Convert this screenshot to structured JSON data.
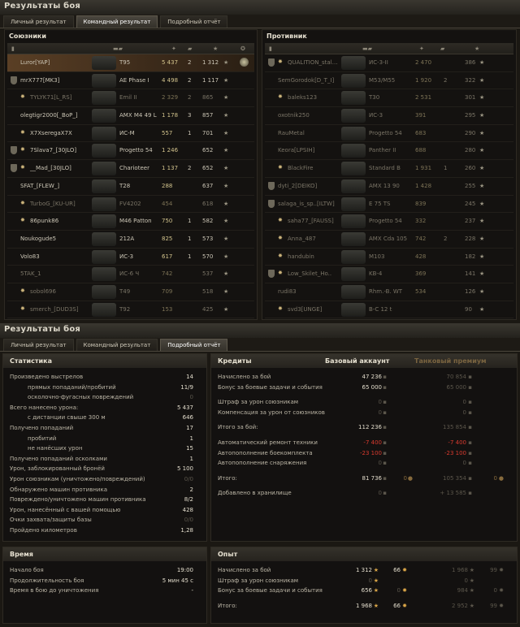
{
  "window_title": "Результаты боя",
  "tabs": [
    "Личный результат",
    "Командный результат",
    "Подробный отчёт"
  ],
  "allies": {
    "title": "Союзники",
    "rows": [
      {
        "name": "Luror[YAP]",
        "tank": "T95",
        "dmg": "5 437",
        "kills": "2",
        "xp": "1 312",
        "me": true
      },
      {
        "name": "mrX777[MK3]",
        "tank": "AE Phase I",
        "dmg": "4 498",
        "kills": "2",
        "xp": "1 117",
        "clan": true
      },
      {
        "name": "TYLYK71[L_RS]",
        "tank": "Emil II",
        "dmg": "2 329",
        "kills": "2",
        "xp": "865",
        "dead": true,
        "badge": true
      },
      {
        "name": "olegtigr2000[_BoP_]",
        "tank": "AMX M4 49 L",
        "dmg": "1 178",
        "kills": "3",
        "xp": "857"
      },
      {
        "name": "X7XseregaX7X",
        "tank": "ИС-М",
        "dmg": "557",
        "kills": "1",
        "xp": "701",
        "badge": true
      },
      {
        "name": "7Slava7_[30JLO]",
        "tank": "Progetto 54",
        "dmg": "1 246",
        "kills": "",
        "xp": "652",
        "clan": true,
        "badge": true
      },
      {
        "name": "__Mad_[30JLO]",
        "tank": "Charioteer",
        "dmg": "1 137",
        "kills": "2",
        "xp": "652",
        "clan": true,
        "badge": true
      },
      {
        "name": "SFAT_[FLEW_]",
        "tank": "T28",
        "dmg": "288",
        "kills": "",
        "xp": "637"
      },
      {
        "name": "TurboG_[KU-UR]",
        "tank": "FV4202",
        "dmg": "454",
        "kills": "",
        "xp": "618",
        "dead": true,
        "badge": true
      },
      {
        "name": "86punk86",
        "tank": "M46 Patton",
        "dmg": "750",
        "kills": "1",
        "xp": "582",
        "badge": true
      },
      {
        "name": "Noukogude5",
        "tank": "212A",
        "dmg": "825",
        "kills": "1",
        "xp": "573"
      },
      {
        "name": "Volo83",
        "tank": "ИС-3",
        "dmg": "617",
        "kills": "1",
        "xp": "570"
      },
      {
        "name": "5TAK_1",
        "tank": "ИС-6 Ч",
        "dmg": "742",
        "kills": "",
        "xp": "537",
        "dead": true
      },
      {
        "name": "sobol696",
        "tank": "T49",
        "dmg": "709",
        "kills": "",
        "xp": "518",
        "dead": true,
        "badge": true
      },
      {
        "name": "smerch_[DUD3S]",
        "tank": "T92",
        "dmg": "153",
        "kills": "",
        "xp": "425",
        "dead": true,
        "badge": true
      }
    ]
  },
  "enemies": {
    "title": "Противник",
    "rows": [
      {
        "name": "QUALITION_stal…",
        "tank": "ИС-3-II",
        "dmg": "2 470",
        "kills": "",
        "xp": "386",
        "dead": true,
        "clan": true,
        "badge": true
      },
      {
        "name": "SemGorodok[D_T_I]",
        "tank": "M53/M55",
        "dmg": "1 920",
        "kills": "2",
        "xp": "322",
        "dead": true
      },
      {
        "name": "baleks123",
        "tank": "T30",
        "dmg": "2 531",
        "kills": "",
        "xp": "301",
        "dead": true,
        "badge": true
      },
      {
        "name": "oxotnik250",
        "tank": "ИС-3",
        "dmg": "391",
        "kills": "",
        "xp": "295",
        "dead": true
      },
      {
        "name": "RauMetal",
        "tank": "Progetto 54",
        "dmg": "683",
        "kills": "",
        "xp": "290",
        "dead": true
      },
      {
        "name": "Keora[LPSIH]",
        "tank": "Panther II",
        "dmg": "688",
        "kills": "",
        "xp": "280",
        "dead": true
      },
      {
        "name": "BlackFire",
        "tank": "Standard B",
        "dmg": "1 931",
        "kills": "1",
        "xp": "260",
        "dead": true,
        "badge": true
      },
      {
        "name": "dyti_2[DEIKO]",
        "tank": "AMX 13 90",
        "dmg": "1 428",
        "kills": "",
        "xp": "255",
        "dead": true,
        "clan": true
      },
      {
        "name": "salaga_is_sp..[ILTW]",
        "tank": "E 75 TS",
        "dmg": "839",
        "kills": "",
        "xp": "245",
        "dead": true,
        "clan": true
      },
      {
        "name": "saha77_[FAUSS]",
        "tank": "Progetto 54",
        "dmg": "332",
        "kills": "",
        "xp": "237",
        "dead": true,
        "badge": true
      },
      {
        "name": "Anna_487",
        "tank": "AMX Cda 105",
        "dmg": "742",
        "kills": "2",
        "xp": "228",
        "dead": true,
        "badge": true
      },
      {
        "name": "handubin",
        "tank": "M103",
        "dmg": "428",
        "kills": "",
        "xp": "182",
        "dead": true,
        "badge": true
      },
      {
        "name": "Low_Skilet_Ho..",
        "tank": "KB-4",
        "dmg": "369",
        "kills": "",
        "xp": "141",
        "dead": true,
        "clan": true,
        "badge": true
      },
      {
        "name": "rudi83",
        "tank": "Rhm.-B. WT",
        "dmg": "534",
        "kills": "",
        "xp": "126",
        "dead": true
      },
      {
        "name": "svd3[UNGE]",
        "tank": "B-C 12 t",
        "dmg": "",
        "kills": "",
        "xp": "90",
        "dead": true,
        "badge": true
      }
    ]
  },
  "stats": {
    "title": "Статистика",
    "rows": [
      {
        "label": "Произведено выстрелов",
        "value": "14"
      },
      {
        "label": "прямых попаданий/пробитий",
        "value": "11/9",
        "indent": true
      },
      {
        "label": "осколочно-фугасных повреждений",
        "value": "0",
        "indent": true,
        "dim": true
      },
      {
        "label": "Всего нанесено урона:",
        "value": "5 437"
      },
      {
        "label": "с дистанции свыше 300 м",
        "value": "646",
        "indent": true
      },
      {
        "label": "Получено попаданий",
        "value": "17"
      },
      {
        "label": "пробитий",
        "value": "1",
        "indent": true
      },
      {
        "label": "не нанёсших урон",
        "value": "15",
        "indent": true
      },
      {
        "label": "Получено попаданий осколками",
        "value": "1"
      },
      {
        "label": "Урон, заблокированный бронёй",
        "value": "5 100"
      },
      {
        "label": "Урон союзникам (уничтожено/повреждений)",
        "value": "0/0",
        "dim": true
      },
      {
        "label": "Обнаружено машин противника",
        "value": "2"
      },
      {
        "label": "Повреждено/уничтожено машин противника",
        "value": "8/2"
      },
      {
        "label": "Урон, нанесённый с вашей помощью",
        "value": "428"
      },
      {
        "label": "Очки захвата/защиты базы",
        "value": "0/0",
        "dim": true
      },
      {
        "label": "Пройдено километров",
        "value": "1,28"
      }
    ]
  },
  "time": {
    "title": "Время",
    "rows": [
      {
        "label": "Начало боя",
        "value": "19:00"
      },
      {
        "label": "Продолжительность боя",
        "value": "5 мин 45 с"
      },
      {
        "label": "Время в бою до уничтожения",
        "value": "-"
      }
    ]
  },
  "credits": {
    "title": "Кредиты",
    "basic_label": "Базовый аккаунт",
    "premium_label": "Танковый премиум",
    "rows": [
      {
        "label": "Начислено за бой",
        "basic": "47 236",
        "prem": "70 854"
      },
      {
        "label": "Бонус за боевые задачи и события",
        "basic": "65 000",
        "prem": "65 000"
      },
      {
        "gap": true
      },
      {
        "label": "Штраф за урон союзникам",
        "basic": "0",
        "prem": "0",
        "dimb": true
      },
      {
        "label": "Компенсация за урон от союзников",
        "basic": "0",
        "prem": "0",
        "dimb": true
      },
      {
        "gap": true
      },
      {
        "label": "Итого за бой:",
        "basic": "112 236",
        "prem": "135 854"
      },
      {
        "gap": true
      },
      {
        "label": "Автоматический ремонт техники",
        "basic": "-7 400",
        "prem": "-7 400",
        "neg": true
      },
      {
        "label": "Автопополнение боекомплекта",
        "basic": "-23 100",
        "prem": "-23 100",
        "neg": true
      },
      {
        "label": "Автопополнение снаряжения",
        "basic": "0",
        "prem": "0",
        "dimb": true
      },
      {
        "gap": true
      },
      {
        "label": "Итого:",
        "basic": "81 736",
        "bgold": "0",
        "prem": "105 354",
        "pgold": "0"
      },
      {
        "gap": true
      },
      {
        "label": "Добавлено в хранилище",
        "basic": "0",
        "prem": "+ 13 585",
        "dimb": true
      }
    ]
  },
  "xp": {
    "title": "Опыт",
    "rows": [
      {
        "label": "Начислено за бой",
        "basic": "1 312",
        "bfree": "66",
        "prem": "1 968",
        "pfree": "99"
      },
      {
        "label": "Штраф за урон союзникам",
        "basic": "0",
        "prem": "0",
        "dimb": true
      },
      {
        "label": "Бонус за боевые задачи и события",
        "basic": "656",
        "bfree": "0",
        "prem": "984",
        "pfree": "0"
      },
      {
        "gap": true
      },
      {
        "label": "Итого:",
        "basic": "1 968",
        "bfree": "66",
        "prem": "2 952",
        "pfree": "99"
      }
    ]
  }
}
